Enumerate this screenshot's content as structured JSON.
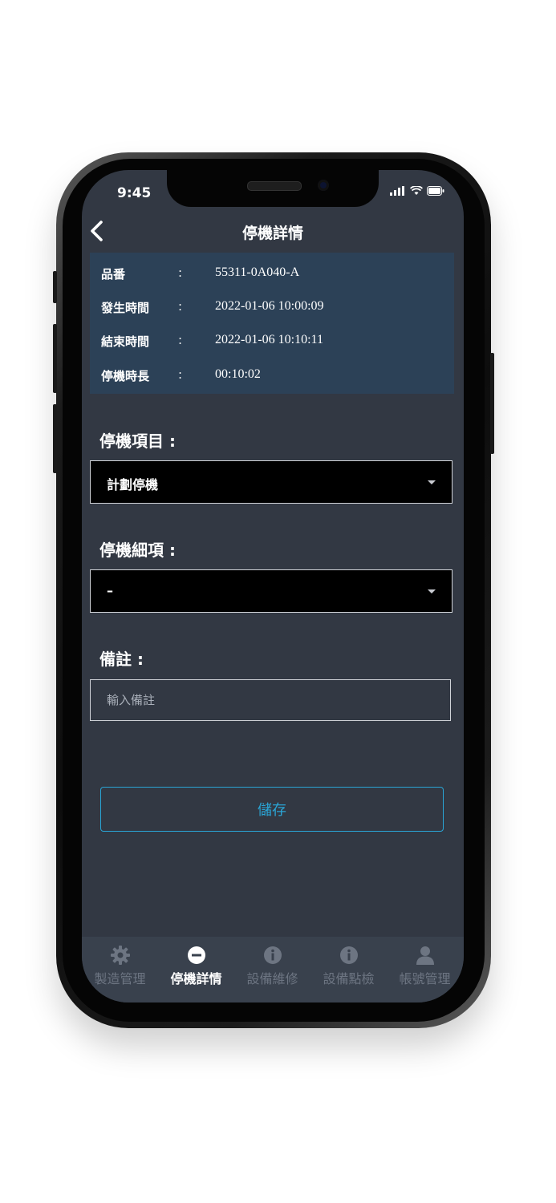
{
  "status_bar": {
    "time": "9:45"
  },
  "header": {
    "title": "停機詳情"
  },
  "info": {
    "rows": [
      {
        "label": "品番",
        "colon": ":",
        "value": "55311-0A040-A"
      },
      {
        "label": "發生時間",
        "colon": ":",
        "value": "2022-01-06 10:00:09"
      },
      {
        "label": "結束時間",
        "colon": ":",
        "value": "2022-01-06 10:10:11"
      },
      {
        "label": "停機時長",
        "colon": ":",
        "value": "00:10:02"
      }
    ]
  },
  "form": {
    "stop_item_label": "停機項目 :",
    "stop_item_value": "計劃停機",
    "stop_detail_label": "停機細項 :",
    "stop_detail_value": "–",
    "note_label": "備註 :",
    "note_placeholder": "輸入備註",
    "note_value": ""
  },
  "actions": {
    "save_label": "儲存"
  },
  "tab_bar": {
    "tabs": [
      {
        "label": "製造管理",
        "icon": "gear-icon",
        "active": false
      },
      {
        "label": "停機詳情",
        "icon": "minus-circle-icon",
        "active": true
      },
      {
        "label": "設備維修",
        "icon": "info-circle-icon",
        "active": false
      },
      {
        "label": "設備點檢",
        "icon": "info-circle-icon",
        "active": false
      },
      {
        "label": "帳號管理",
        "icon": "user-icon",
        "active": false
      }
    ]
  },
  "colors": {
    "screen_bg": "#323843",
    "info_panel_bg": "#2c4157",
    "accent": "#2aa5d6",
    "tab_inactive": "#6d7582"
  }
}
